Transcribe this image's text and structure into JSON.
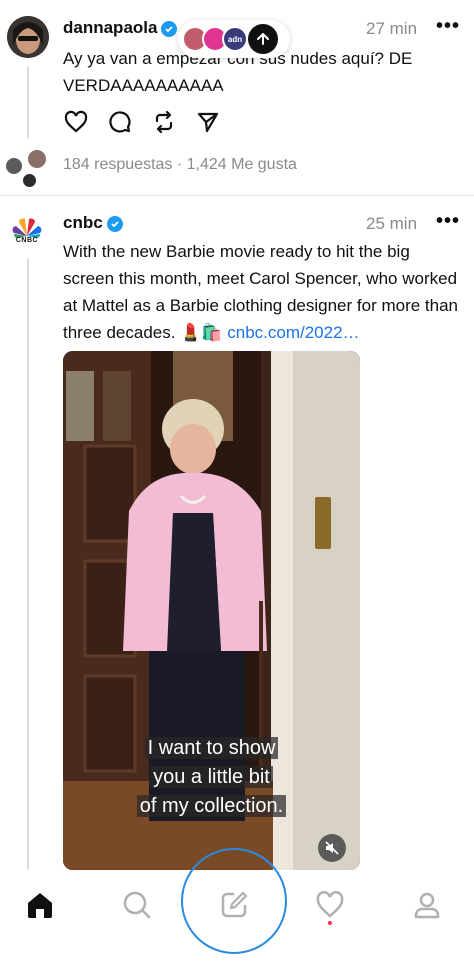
{
  "post1": {
    "username": "dannapaola",
    "time": "27 min",
    "more": "•••",
    "text": "Ay ya van a empezar con sus nudes aquí? DE VERDAAAAAAAAAA",
    "stats": "184 respuestas · 1,424 Me gusta"
  },
  "floating_badge": {
    "avatar_labels": [
      "",
      "",
      "adn"
    ]
  },
  "post2": {
    "username": "cnbc",
    "avatar_label": "CNBC",
    "time": "25 min",
    "more": "•••",
    "text": "With the new Barbie movie ready to hit the big screen this month, meet Carol Spencer, who worked at Mattel as a Barbie clothing designer for more than three decades. 💄🛍️ ",
    "link": "cnbc.com/2022…",
    "video_caption_lines": [
      "I want to show",
      "you a little bit",
      "of my collection."
    ]
  },
  "tabbar": {
    "tabs": [
      "home",
      "search",
      "compose",
      "activity",
      "profile"
    ]
  },
  "colors": {
    "verified": "#1d9bf0",
    "link": "#1a73e8",
    "ring": "#2a8ae0",
    "notification_dot": "#ff3040"
  }
}
